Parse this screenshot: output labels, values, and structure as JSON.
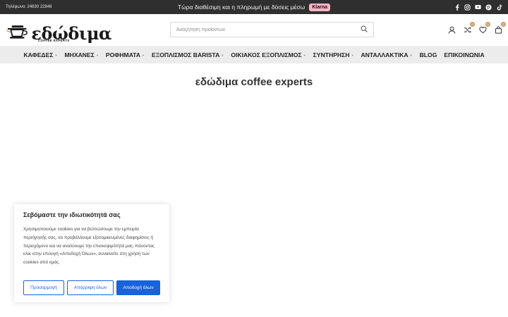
{
  "topbar": {
    "phone": "Τηλέφωνο: 24630 22848",
    "promo": "Τώρα διαθέσιμη και η πληρωμή με δόσεις μέσω",
    "klarna": "Klarna",
    "socials": [
      "facebook-icon",
      "instagram-icon",
      "youtube-icon",
      "pinterest-icon",
      "tiktok-icon"
    ]
  },
  "header": {
    "brand": "εδώδιμα",
    "tagline": "COFFEE EXPERTS",
    "search_placeholder": "Αναζήτηση προϊόντων",
    "icons": {
      "account": "user-icon",
      "compare": "compare-icon",
      "compare_count": "0",
      "wishlist": "heart-icon",
      "wishlist_count": "0",
      "cart": "bag-icon",
      "cart_count": "0"
    }
  },
  "nav": {
    "items": [
      {
        "label": "ΚΑΦΕΔΕΣ",
        "has_dropdown": true
      },
      {
        "label": "ΜΗΧΑΝΕΣ",
        "has_dropdown": true
      },
      {
        "label": "ΡΟΦΗΜΑΤΑ",
        "has_dropdown": true
      },
      {
        "label": "ΕΞΟΠΛΙΣΜΟΣ BARISTA",
        "has_dropdown": true
      },
      {
        "label": "ΟΙΚΙΑΚΟΣ ΕΞΟΠΛΙΣΜΟΣ",
        "has_dropdown": true
      },
      {
        "label": "ΣΥΝΤΗΡΗΣΗ",
        "has_dropdown": true
      },
      {
        "label": "ΑΝΤΑΛΛΑΚΤΙΚΑ",
        "has_dropdown": true
      },
      {
        "label": "BLOG",
        "has_dropdown": false
      },
      {
        "label": "ΕΠΙΚΟΙΝΩΝΙΑ",
        "has_dropdown": false
      }
    ]
  },
  "main": {
    "title": "εδώδιμα coffee experts"
  },
  "cookie": {
    "title": "Σεβόμαστε την ιδιωτικότητά σας",
    "text": "Χρησιμοποιούμε cookies για να βελτιώσουμε την εμπειρία περιήγησής σας, να προβάλλουμε εξατομικευμένες διαφημίσεις ή περιεχόμενο και να αναλύουμε την επισκεψιμότητά μας. Κάνοντας κλικ στην επιλογή «Αποδοχή Όλων», συναινείτε στη χρήση των cookies από εμάς.",
    "customize": "Προσαρμογή",
    "reject": "Απόρριψη όλων",
    "accept": "Αποδοχή όλων"
  },
  "colors": {
    "topbar_bg": "#2f2f2f",
    "nav_bg": "#ececec",
    "accent_blue": "#1863dc",
    "badge": "#c9996b",
    "klarna_pink": "#ffb3c7"
  }
}
